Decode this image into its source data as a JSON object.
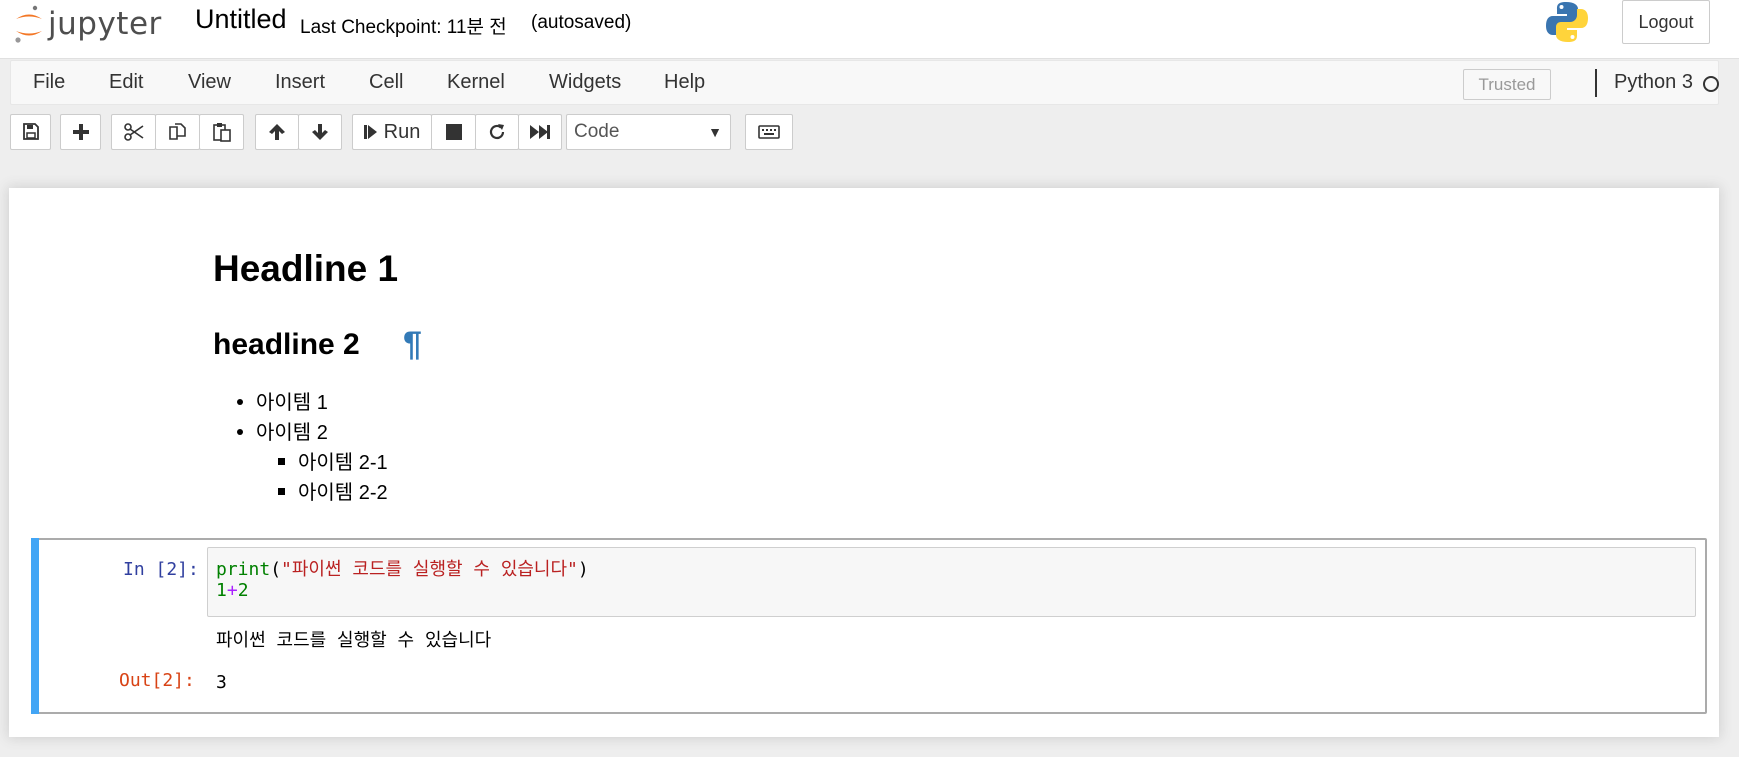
{
  "header": {
    "logo_text": "jupyter",
    "notebook_title": "Untitled",
    "checkpoint": "Last Checkpoint: 11분 전",
    "autosave": "(autosaved)",
    "logout_label": "Logout"
  },
  "menubar": {
    "items": [
      "File",
      "Edit",
      "View",
      "Insert",
      "Cell",
      "Kernel",
      "Widgets",
      "Help"
    ],
    "trusted": "Trusted",
    "kernel_name": "Python 3"
  },
  "toolbar": {
    "run_label": "Run",
    "cell_type": "Code"
  },
  "markdown_cell": {
    "h1": "Headline 1",
    "h2": "headline 2",
    "anchor": "¶",
    "items": [
      "아이템 1",
      "아이템 2"
    ],
    "subitems": [
      "아이템 2-1",
      "아이템 2-2"
    ]
  },
  "code_cell": {
    "in_prompt": "In [2]:",
    "line1": {
      "func": "print",
      "open": "(",
      "string": "\"파이썬 코드를 실행할 수 있습니다\"",
      "close": ")"
    },
    "line2": {
      "a": "1",
      "op": "+",
      "b": "2"
    },
    "stdout": "파이썬 코드를 실행할 수 있습니다",
    "out_prompt": "Out[2]:",
    "out_value": "3"
  },
  "colors": {
    "selected_cell_bar": "#42a5f5",
    "in_prompt": "#303f9f",
    "out_prompt": "#d84315",
    "anchor_link": "#337ab7"
  }
}
